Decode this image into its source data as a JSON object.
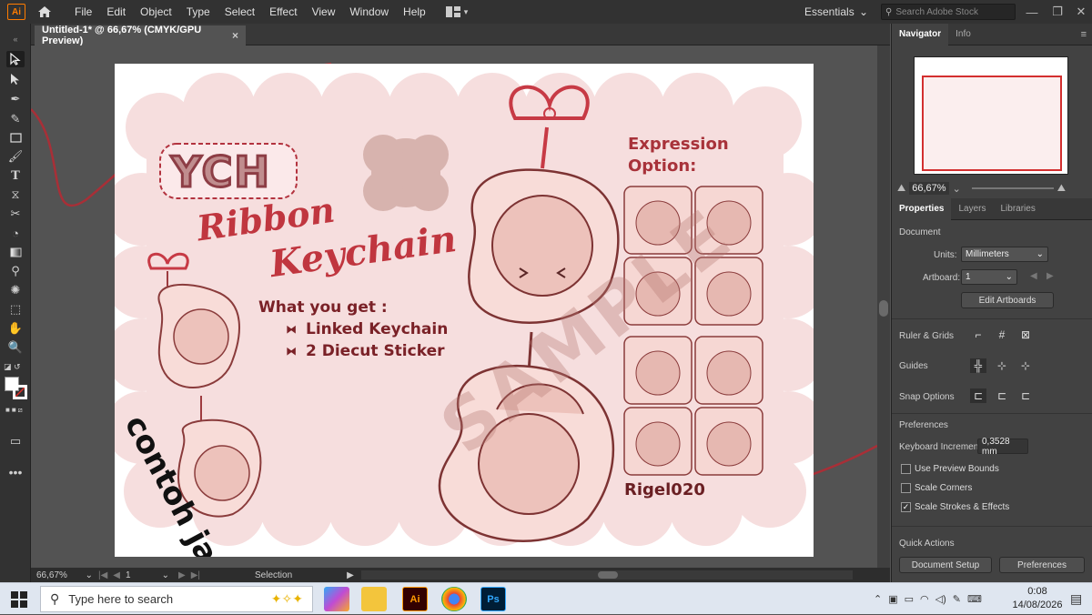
{
  "app": {
    "logo": "Ai",
    "menus": [
      "File",
      "Edit",
      "Object",
      "Type",
      "Select",
      "Effect",
      "View",
      "Window",
      "Help"
    ],
    "workspace": "Essentials",
    "stock_search_placeholder": "Search Adobe Stock",
    "doc_tab": "Untitled-1* @ 66,67% (CMYK/GPU Preview)",
    "doc_tab_close": "×",
    "accent_color": "#ff7c00"
  },
  "artwork": {
    "title_ych": "YCH",
    "title_ribbon": "Ribbon",
    "title_keychain": "Keychain",
    "what_you_get": "What you get :",
    "items": [
      "Linked Keychain",
      "2 Diecut Sticker"
    ],
    "expression_title_1": "Expression",
    "expression_title_2": "Option:",
    "watermark": "SAMPLE",
    "sample_text": "contoh jadi",
    "artist": "Rigel020",
    "accent_color": "#b3333f",
    "bg_blob_color": "#f6dede"
  },
  "statusbar": {
    "zoom": "66,67%",
    "artboard_num": "1",
    "tool": "Selection"
  },
  "panel": {
    "tabs_top": [
      "Navigator",
      "Info"
    ],
    "nav_zoom": "66,67%",
    "tabs": [
      "Properties",
      "Layers",
      "Libraries"
    ],
    "document_label": "Document",
    "units_label": "Units:",
    "units_value": "Millimeters",
    "artboard_label": "Artboard:",
    "artboard_value": "1",
    "edit_artboards": "Edit Artboards",
    "ruler_grids": "Ruler & Grids",
    "guides": "Guides",
    "snap_options": "Snap Options",
    "preferences": "Preferences",
    "keyboard_increment_label": "Keyboard Increment:",
    "keyboard_increment_value": "0,3528 mm",
    "checks": [
      {
        "label": "Use Preview Bounds",
        "checked": false
      },
      {
        "label": "Scale Corners",
        "checked": false
      },
      {
        "label": "Scale Strokes & Effects",
        "checked": true
      }
    ],
    "quick_actions": "Quick Actions",
    "document_setup": "Document Setup",
    "preferences_btn": "Preferences"
  },
  "taskbar": {
    "search_placeholder": "Type here to search",
    "time": "0:08",
    "date": "14/08/2026"
  }
}
